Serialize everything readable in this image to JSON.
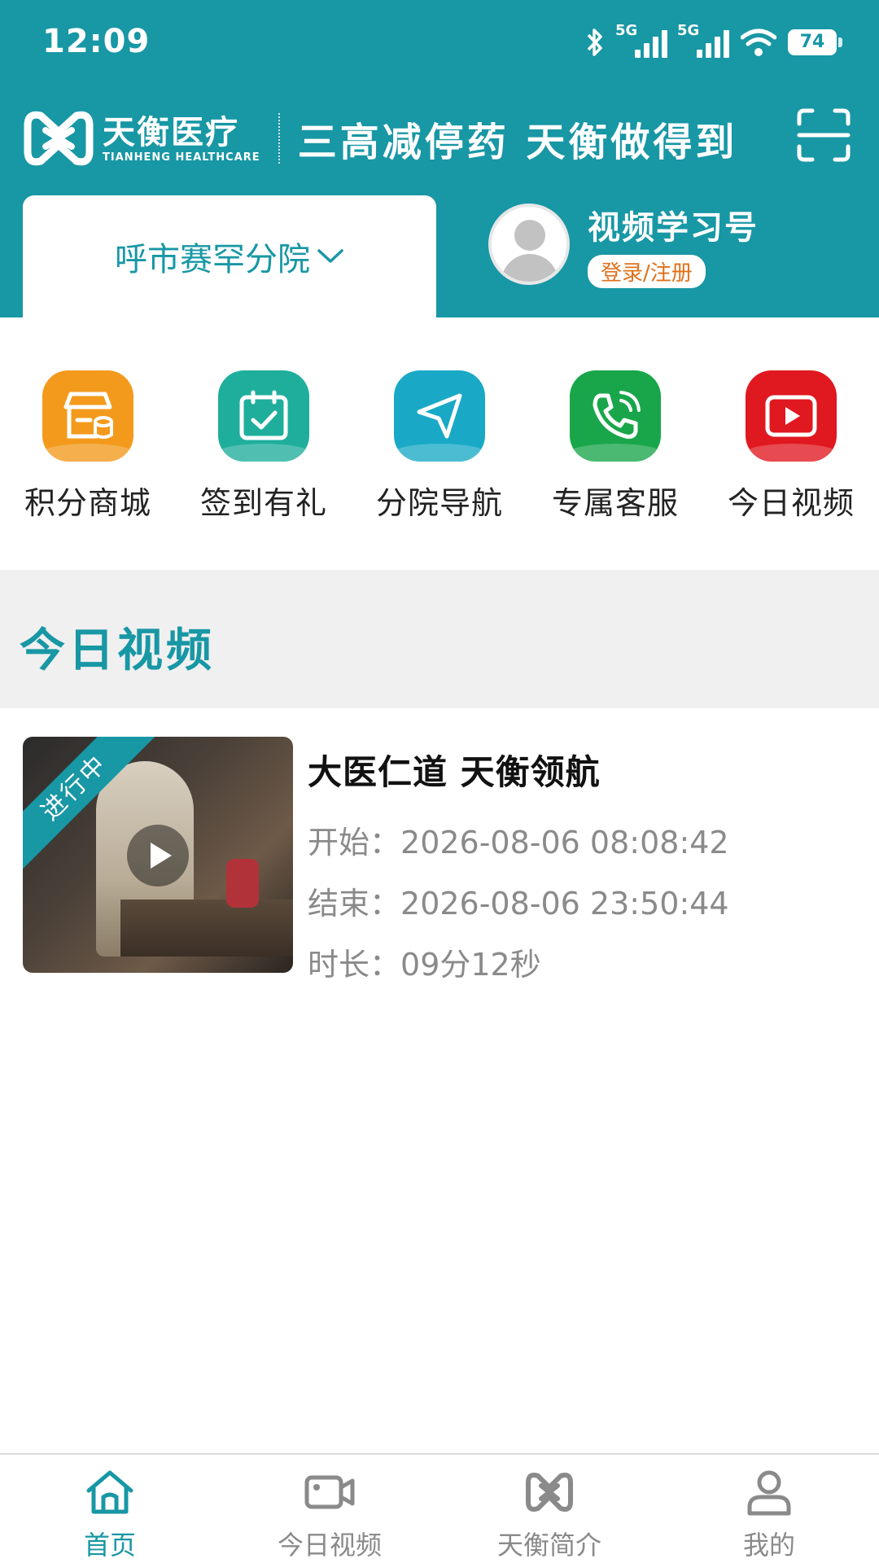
{
  "status_bar": {
    "time": "12:09",
    "signal1_label": "5G",
    "signal2_label": "5G",
    "battery": "74"
  },
  "header": {
    "brand_cn": "天衡医疗",
    "brand_en": "TIANHENG HEALTHCARE",
    "slogan": "三高减停药 天衡做得到",
    "branch": "呼市赛罕分院",
    "user_name": "视频学习号",
    "login_label": "登录/注册"
  },
  "shortcuts": [
    {
      "label": "积分商城",
      "icon": "store-icon",
      "color": "#f39a1c"
    },
    {
      "label": "签到有礼",
      "icon": "calendar-check-icon",
      "color": "#1fae9c"
    },
    {
      "label": "分院导航",
      "icon": "navigation-icon",
      "color": "#19a9c6"
    },
    {
      "label": "专属客服",
      "icon": "phone-icon",
      "color": "#19a64a"
    },
    {
      "label": "今日视频",
      "icon": "play-icon",
      "color": "#e0181f"
    }
  ],
  "section": {
    "title": "今日视频"
  },
  "video": {
    "badge": "进行中",
    "title": "大医仁道 天衡领航",
    "start_label": "开始：",
    "start": "2026-08-06 08:08:42",
    "end_label": "结束：",
    "end": "2026-08-06 23:50:44",
    "duration_label": "时长：",
    "duration": "09分12秒"
  },
  "bottom_nav": [
    {
      "label": "首页",
      "icon": "home-icon",
      "active": true
    },
    {
      "label": "今日视频",
      "icon": "video-camera-icon",
      "active": false
    },
    {
      "label": "天衡简介",
      "icon": "logo-icon",
      "active": false
    },
    {
      "label": "我的",
      "icon": "user-icon",
      "active": false
    }
  ],
  "colors": {
    "brand": "#1897a5",
    "accent_orange": "#e0701a"
  }
}
